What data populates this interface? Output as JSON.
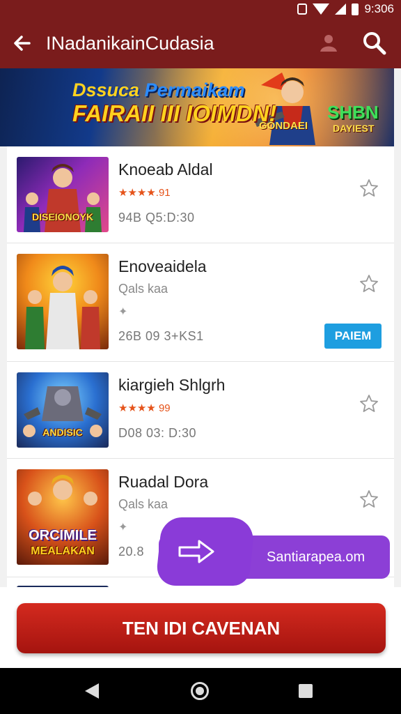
{
  "status_bar": {
    "time": "9:306"
  },
  "app_bar": {
    "title": "INadanikainCudasia"
  },
  "banner": {
    "line1_a": "Dssuca",
    "line1_b": "Permaikam",
    "line2": "FAIRAII III IOIMDN!",
    "badge_a": "GONDAEI",
    "badge_b": "SHBN",
    "badge_c": "DAYIEST"
  },
  "games": [
    {
      "title": "Knoeab Aldal",
      "rating": "★★★★.91",
      "meta": "94B Q5:D:30",
      "thumb_label": "DISEIONOYK"
    },
    {
      "title": "Enoveaidela",
      "subtitle": "Qals kaa",
      "meta": "26B 09 3+KS1",
      "badge": "PAIEM"
    },
    {
      "title": "kiargieh Shlgrh",
      "rating": "★★★★ 99",
      "meta": "D08 03: D:30",
      "thumb_label": "ANDISIC"
    },
    {
      "title": "Ruadal Dora",
      "subtitle": "Qals kaa",
      "meta": "20.8",
      "thumb_label": "ORCIMILE",
      "thumb_label_2": "MEALAKAN"
    }
  ],
  "fab": {
    "label": "Santiarapea.om"
  },
  "cta": {
    "label": "TEN IDI CAVENAN"
  },
  "colors": {
    "app_bar": "#7a1c1c",
    "cta": "#c21d18",
    "fab": "#8c3fd6",
    "badge": "#1e9ee0"
  }
}
